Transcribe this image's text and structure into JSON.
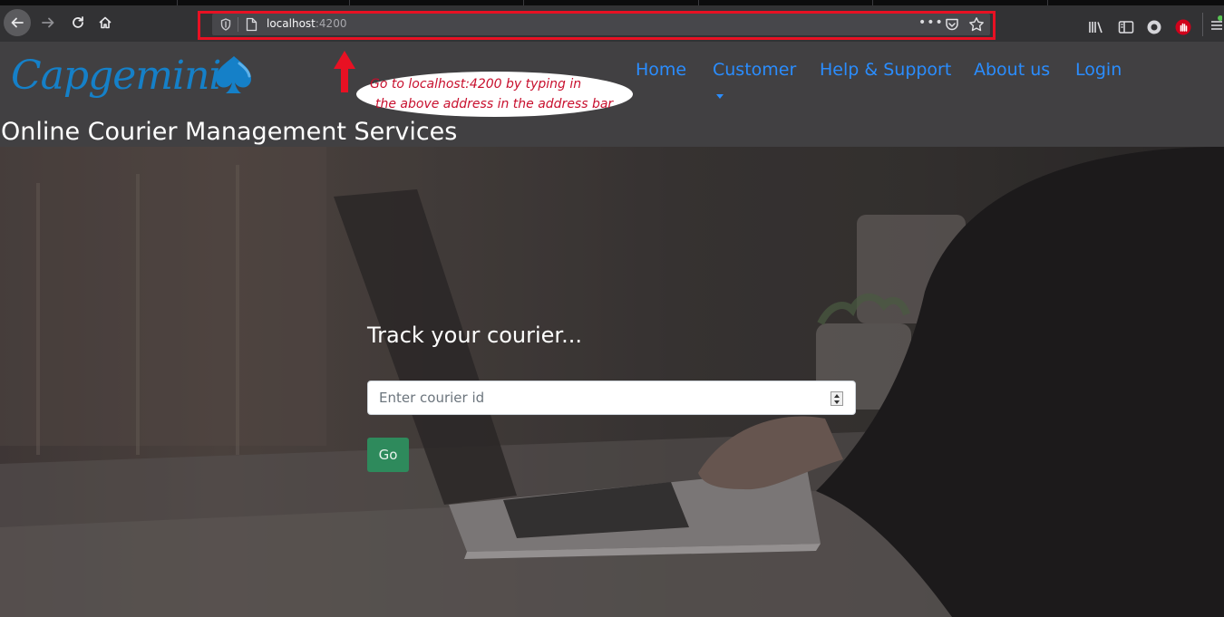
{
  "browser": {
    "url_host": "localhost",
    "url_port": ":4200",
    "more_glyph": "•••"
  },
  "site": {
    "logo_text": "Capgemini",
    "title": "Online Courier Management Services",
    "nav": {
      "home": "Home",
      "customer": "Customer",
      "help": "Help & Support",
      "about": "About us",
      "login": "Login"
    }
  },
  "annotation": {
    "line1": "Go to localhost:4200 by typing in",
    "line2": "the above address in the address bar",
    "color": "#e81123"
  },
  "hero": {
    "heading": "Track your courier...",
    "input_placeholder": "Enter courier id",
    "go_label": "Go"
  },
  "colors": {
    "nav_link": "#2a8dff",
    "header_bg": "#414042",
    "logo": "#1580c8",
    "go_button": "#2e8a5c"
  }
}
